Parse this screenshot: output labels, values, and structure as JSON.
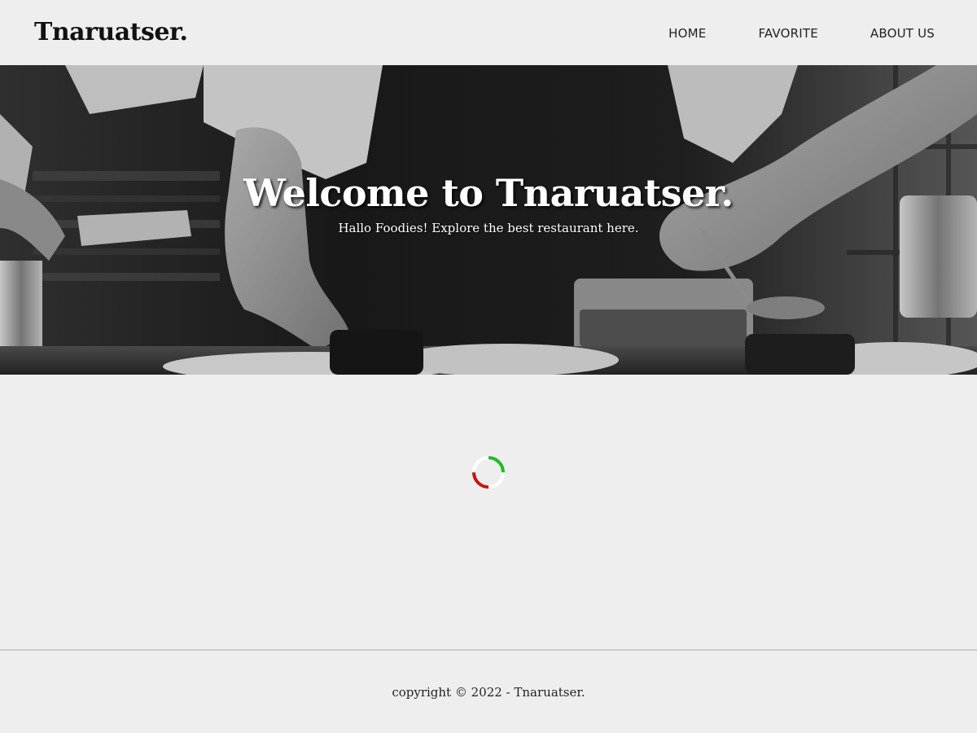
{
  "header": {
    "brand": "Tnaruatser.",
    "nav": [
      {
        "label": "HOME"
      },
      {
        "label": "FAVORITE"
      },
      {
        "label": "ABOUT US"
      }
    ]
  },
  "hero": {
    "title": "Welcome to Tnaruatser.",
    "subtitle": "Hallo Foodies! Explore the best restaurant here."
  },
  "loader": {
    "colors": {
      "track": "#ffffff",
      "top_arc": "#22bb22",
      "bottom_arc": "#cc1111"
    }
  },
  "footer": {
    "copyright": "copyright © 2022 - Tnaruatser."
  },
  "colors": {
    "background": "#eeeeee",
    "text": "#111111",
    "hero_text": "#ffffff"
  }
}
